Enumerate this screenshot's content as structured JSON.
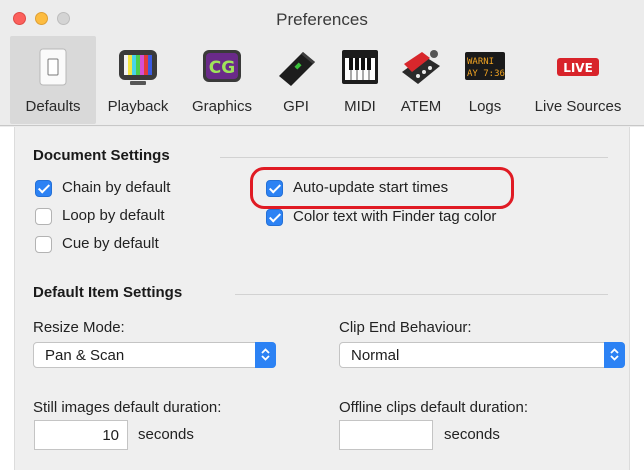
{
  "window": {
    "title": "Preferences"
  },
  "toolbar": {
    "items": [
      {
        "label": "Defaults",
        "icon": "switch-icon"
      },
      {
        "label": "Playback",
        "icon": "tv-icon"
      },
      {
        "label": "Graphics",
        "icon": "cg-graphics-icon"
      },
      {
        "label": "GPI",
        "icon": "gpi-device-icon"
      },
      {
        "label": "MIDI",
        "icon": "piano-keyboard-icon"
      },
      {
        "label": "ATEM",
        "icon": "atem-switcher-icon"
      },
      {
        "label": "Logs",
        "icon": "log-display-icon",
        "icon_text_1": "WARNI",
        "icon_text_2": "AY 7:36"
      },
      {
        "label": "Live Sources",
        "icon": "live-icon",
        "icon_text": "LIVE"
      }
    ],
    "selected": "Defaults"
  },
  "document_settings": {
    "title": "Document Settings",
    "chain_by_default": {
      "label": "Chain by default",
      "checked": true
    },
    "loop_by_default": {
      "label": "Loop by default",
      "checked": false
    },
    "cue_by_default": {
      "label": "Cue by default",
      "checked": false
    },
    "auto_update_start_times": {
      "label": "Auto-update start times",
      "checked": true
    },
    "color_text_finder_tag": {
      "label": "Color text with Finder tag color",
      "checked": true
    }
  },
  "default_item_settings": {
    "title": "Default Item Settings",
    "resize_mode": {
      "label": "Resize Mode:",
      "value": "Pan & Scan"
    },
    "clip_end_behaviour": {
      "label": "Clip End Behaviour:",
      "value": "Normal"
    },
    "still_images_duration": {
      "label": "Still images default duration:",
      "value": "10",
      "unit": "seconds"
    },
    "offline_clips_duration": {
      "label": "Offline clips default duration:",
      "value": "",
      "unit": "seconds"
    }
  },
  "colors": {
    "accent": "#2c82f4",
    "highlight": "#e01b24",
    "live_badge": "#d8232a"
  }
}
